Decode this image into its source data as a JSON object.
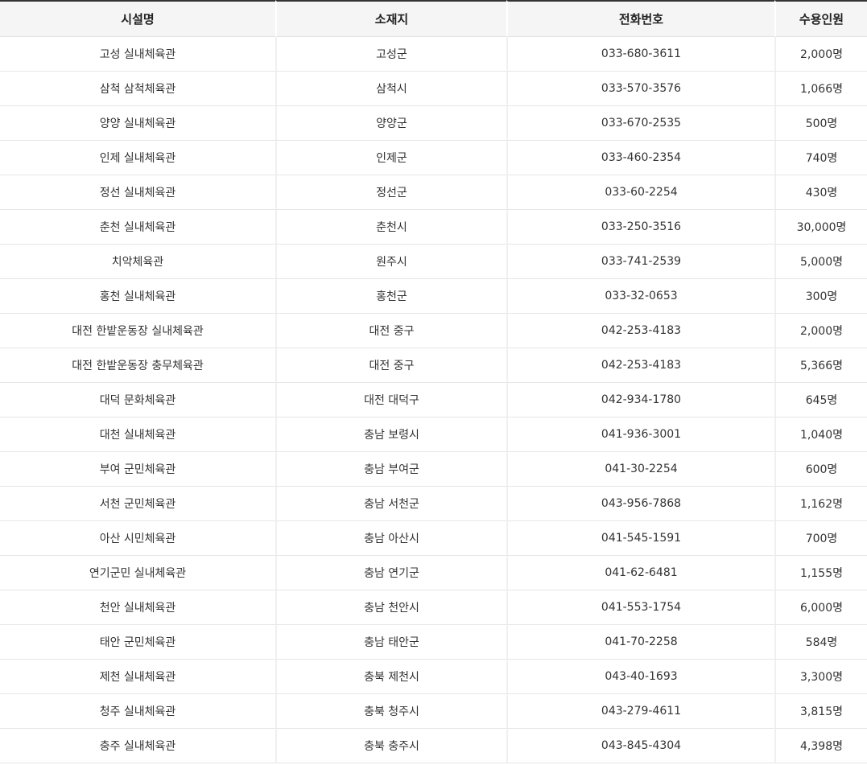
{
  "table": {
    "headers": [
      "시설명",
      "소재지",
      "전화번호",
      "수용인원"
    ],
    "rows": [
      [
        "고성 실내체육관",
        "고성군",
        "033-680-3611",
        "2,000명"
      ],
      [
        "삼척 삼척체육관",
        "삼척시",
        "033-570-3576",
        "1,066명"
      ],
      [
        "양양 실내체육관",
        "양양군",
        "033-670-2535",
        "500명"
      ],
      [
        "인제 실내체육관",
        "인제군",
        "033-460-2354",
        "740명"
      ],
      [
        "정선 실내체육관",
        "정선군",
        "033-60-2254",
        "430명"
      ],
      [
        "춘천 실내체육관",
        "춘천시",
        "033-250-3516",
        "30,000명"
      ],
      [
        "치악체육관",
        "원주시",
        "033-741-2539",
        "5,000명"
      ],
      [
        "홍천 실내체육관",
        "홍천군",
        "033-32-0653",
        "300명"
      ],
      [
        "대전 한밭운동장 실내체육관",
        "대전 중구",
        "042-253-4183",
        "2,000명"
      ],
      [
        "대전 한밭운동장 충무체육관",
        "대전 중구",
        "042-253-4183",
        "5,366명"
      ],
      [
        "대덕 문화체육관",
        "대전 대덕구",
        "042-934-1780",
        "645명"
      ],
      [
        "대천 실내체육관",
        "충남 보령시",
        "041-936-3001",
        "1,040명"
      ],
      [
        "부여 군민체육관",
        "충남 부여군",
        "041-30-2254",
        "600명"
      ],
      [
        "서천 군민체육관",
        "충남 서천군",
        "043-956-7868",
        "1,162명"
      ],
      [
        "아산 시민체육관",
        "충남 아산시",
        "041-545-1591",
        "700명"
      ],
      [
        "연기군민 실내체육관",
        "충남 연기군",
        "041-62-6481",
        "1,155명"
      ],
      [
        "천안 실내체육관",
        "충남 천안시",
        "041-553-1754",
        "6,000명"
      ],
      [
        "태안 군민체육관",
        "충남 태안군",
        "041-70-2258",
        "584명"
      ],
      [
        "제천 실내체육관",
        "충북 제천시",
        "043-40-1693",
        "3,300명"
      ],
      [
        "청주 실내체육관",
        "충북 청주시",
        "043-279-4611",
        "3,815명"
      ],
      [
        "충주 실내체육관",
        "충북 충주시",
        "043-845-4304",
        "4,398명"
      ]
    ]
  }
}
